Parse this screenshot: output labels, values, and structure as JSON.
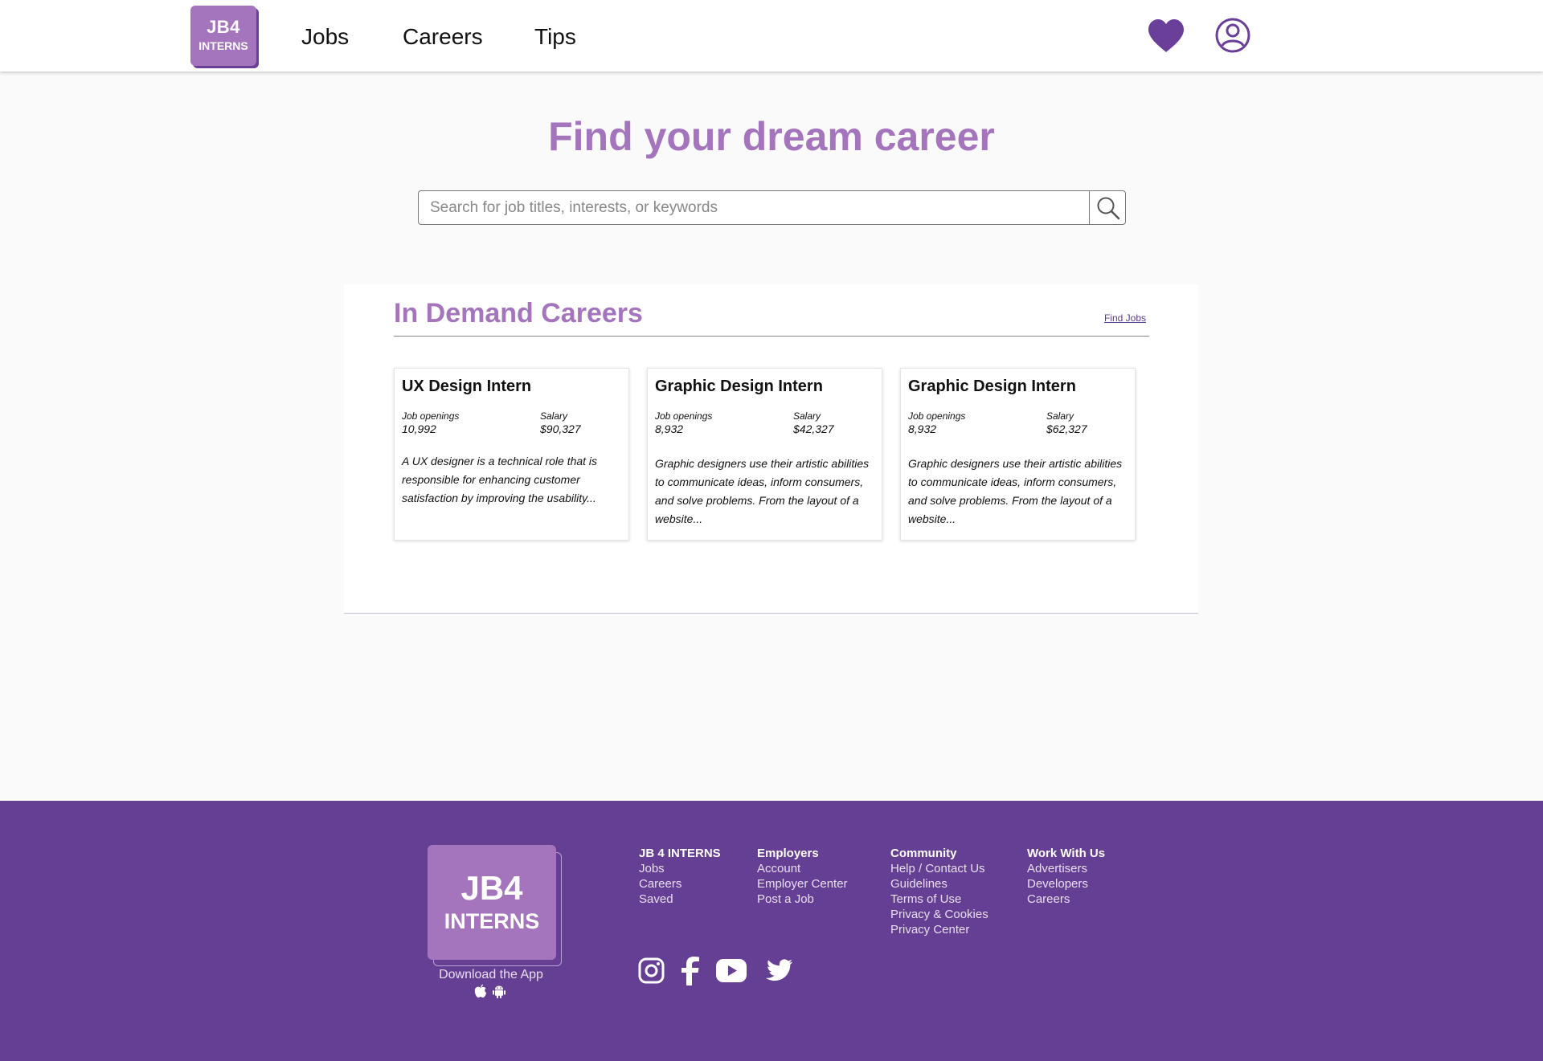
{
  "header": {
    "logo_line1": "JB4",
    "logo_line2": "INTERNS",
    "nav": [
      "Jobs",
      "Careers",
      "Tips"
    ],
    "favorites_icon": "heart-icon",
    "account_icon": "user-circle-icon"
  },
  "hero": {
    "title": "Find your dream career",
    "search_placeholder": "Search for job titles, interests, or keywords",
    "search_icon": "search-icon"
  },
  "demand": {
    "title": "In Demand Careers",
    "find_jobs": "Find Jobs",
    "cards": [
      {
        "title": "UX Design Intern",
        "openings_label": "Job openings",
        "openings": "10,992",
        "salary_label": "Salary",
        "salary": "$90,327",
        "description": "A UX designer is a technical role that is responsible for enhancing customer satisfaction by improving the usability..."
      },
      {
        "title": "Graphic Design Intern",
        "openings_label": "Job openings",
        "openings": "8,932",
        "salary_label": "Salary",
        "salary": "$42,327",
        "description": "Graphic designers use their artistic abilities to communicate ideas, inform consumers, and solve problems. From the layout of a website..."
      },
      {
        "title": "Graphic Design Intern",
        "openings_label": "Job openings",
        "openings": "8,932",
        "salary_label": "Salary",
        "salary": "$62,327",
        "description": "Graphic designers use their artistic abilities to communicate ideas, inform consumers, and solve problems. From the layout of a website..."
      }
    ]
  },
  "footer": {
    "logo_line1": "JB4",
    "logo_line2": "INTERNS",
    "download": "Download the App",
    "columns": [
      {
        "heading": "JB 4 INTERNS",
        "links": [
          "Jobs",
          "Careers",
          "Saved"
        ]
      },
      {
        "heading": "Employers",
        "links": [
          "Account",
          "Employer Center",
          "Post a Job"
        ]
      },
      {
        "heading": "Community",
        "links": [
          "Help / Contact Us",
          "Guidelines",
          "Terms of Use",
          "Privacy & Cookies",
          "Privacy Center"
        ]
      },
      {
        "heading": "Work With Us",
        "links": [
          "Advertisers",
          "Developers",
          "Careers"
        ]
      }
    ],
    "social_icons": [
      "instagram-icon",
      "facebook-icon",
      "youtube-icon",
      "twitter-icon"
    ],
    "app_icons": [
      "apple-icon",
      "android-icon"
    ]
  },
  "colors": {
    "brand_purple": "#653f93",
    "accent_lilac": "#a474bd",
    "icon_purple": "#6a3f9a"
  }
}
